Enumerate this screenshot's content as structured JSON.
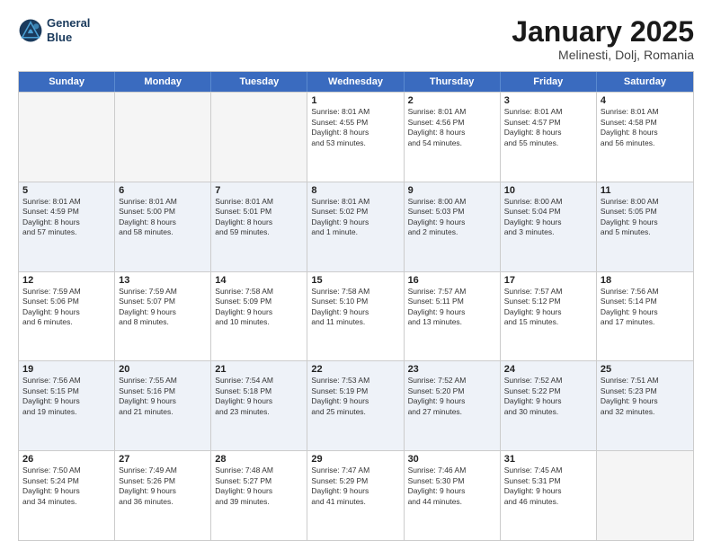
{
  "logo": {
    "line1": "General",
    "line2": "Blue"
  },
  "title": "January 2025",
  "location": "Melinesti, Dolj, Romania",
  "days_header": [
    "Sunday",
    "Monday",
    "Tuesday",
    "Wednesday",
    "Thursday",
    "Friday",
    "Saturday"
  ],
  "weeks": [
    [
      {
        "day": "",
        "empty": true
      },
      {
        "day": "",
        "empty": true
      },
      {
        "day": "",
        "empty": true
      },
      {
        "day": "1",
        "lines": [
          "Sunrise: 8:01 AM",
          "Sunset: 4:55 PM",
          "Daylight: 8 hours",
          "and 53 minutes."
        ]
      },
      {
        "day": "2",
        "lines": [
          "Sunrise: 8:01 AM",
          "Sunset: 4:56 PM",
          "Daylight: 8 hours",
          "and 54 minutes."
        ]
      },
      {
        "day": "3",
        "lines": [
          "Sunrise: 8:01 AM",
          "Sunset: 4:57 PM",
          "Daylight: 8 hours",
          "and 55 minutes."
        ]
      },
      {
        "day": "4",
        "lines": [
          "Sunrise: 8:01 AM",
          "Sunset: 4:58 PM",
          "Daylight: 8 hours",
          "and 56 minutes."
        ]
      }
    ],
    [
      {
        "day": "5",
        "lines": [
          "Sunrise: 8:01 AM",
          "Sunset: 4:59 PM",
          "Daylight: 8 hours",
          "and 57 minutes."
        ]
      },
      {
        "day": "6",
        "lines": [
          "Sunrise: 8:01 AM",
          "Sunset: 5:00 PM",
          "Daylight: 8 hours",
          "and 58 minutes."
        ]
      },
      {
        "day": "7",
        "lines": [
          "Sunrise: 8:01 AM",
          "Sunset: 5:01 PM",
          "Daylight: 8 hours",
          "and 59 minutes."
        ]
      },
      {
        "day": "8",
        "lines": [
          "Sunrise: 8:01 AM",
          "Sunset: 5:02 PM",
          "Daylight: 9 hours",
          "and 1 minute."
        ]
      },
      {
        "day": "9",
        "lines": [
          "Sunrise: 8:00 AM",
          "Sunset: 5:03 PM",
          "Daylight: 9 hours",
          "and 2 minutes."
        ]
      },
      {
        "day": "10",
        "lines": [
          "Sunrise: 8:00 AM",
          "Sunset: 5:04 PM",
          "Daylight: 9 hours",
          "and 3 minutes."
        ]
      },
      {
        "day": "11",
        "lines": [
          "Sunrise: 8:00 AM",
          "Sunset: 5:05 PM",
          "Daylight: 9 hours",
          "and 5 minutes."
        ]
      }
    ],
    [
      {
        "day": "12",
        "lines": [
          "Sunrise: 7:59 AM",
          "Sunset: 5:06 PM",
          "Daylight: 9 hours",
          "and 6 minutes."
        ]
      },
      {
        "day": "13",
        "lines": [
          "Sunrise: 7:59 AM",
          "Sunset: 5:07 PM",
          "Daylight: 9 hours",
          "and 8 minutes."
        ]
      },
      {
        "day": "14",
        "lines": [
          "Sunrise: 7:58 AM",
          "Sunset: 5:09 PM",
          "Daylight: 9 hours",
          "and 10 minutes."
        ]
      },
      {
        "day": "15",
        "lines": [
          "Sunrise: 7:58 AM",
          "Sunset: 5:10 PM",
          "Daylight: 9 hours",
          "and 11 minutes."
        ]
      },
      {
        "day": "16",
        "lines": [
          "Sunrise: 7:57 AM",
          "Sunset: 5:11 PM",
          "Daylight: 9 hours",
          "and 13 minutes."
        ]
      },
      {
        "day": "17",
        "lines": [
          "Sunrise: 7:57 AM",
          "Sunset: 5:12 PM",
          "Daylight: 9 hours",
          "and 15 minutes."
        ]
      },
      {
        "day": "18",
        "lines": [
          "Sunrise: 7:56 AM",
          "Sunset: 5:14 PM",
          "Daylight: 9 hours",
          "and 17 minutes."
        ]
      }
    ],
    [
      {
        "day": "19",
        "lines": [
          "Sunrise: 7:56 AM",
          "Sunset: 5:15 PM",
          "Daylight: 9 hours",
          "and 19 minutes."
        ]
      },
      {
        "day": "20",
        "lines": [
          "Sunrise: 7:55 AM",
          "Sunset: 5:16 PM",
          "Daylight: 9 hours",
          "and 21 minutes."
        ]
      },
      {
        "day": "21",
        "lines": [
          "Sunrise: 7:54 AM",
          "Sunset: 5:18 PM",
          "Daylight: 9 hours",
          "and 23 minutes."
        ]
      },
      {
        "day": "22",
        "lines": [
          "Sunrise: 7:53 AM",
          "Sunset: 5:19 PM",
          "Daylight: 9 hours",
          "and 25 minutes."
        ]
      },
      {
        "day": "23",
        "lines": [
          "Sunrise: 7:52 AM",
          "Sunset: 5:20 PM",
          "Daylight: 9 hours",
          "and 27 minutes."
        ]
      },
      {
        "day": "24",
        "lines": [
          "Sunrise: 7:52 AM",
          "Sunset: 5:22 PM",
          "Daylight: 9 hours",
          "and 30 minutes."
        ]
      },
      {
        "day": "25",
        "lines": [
          "Sunrise: 7:51 AM",
          "Sunset: 5:23 PM",
          "Daylight: 9 hours",
          "and 32 minutes."
        ]
      }
    ],
    [
      {
        "day": "26",
        "lines": [
          "Sunrise: 7:50 AM",
          "Sunset: 5:24 PM",
          "Daylight: 9 hours",
          "and 34 minutes."
        ]
      },
      {
        "day": "27",
        "lines": [
          "Sunrise: 7:49 AM",
          "Sunset: 5:26 PM",
          "Daylight: 9 hours",
          "and 36 minutes."
        ]
      },
      {
        "day": "28",
        "lines": [
          "Sunrise: 7:48 AM",
          "Sunset: 5:27 PM",
          "Daylight: 9 hours",
          "and 39 minutes."
        ]
      },
      {
        "day": "29",
        "lines": [
          "Sunrise: 7:47 AM",
          "Sunset: 5:29 PM",
          "Daylight: 9 hours",
          "and 41 minutes."
        ]
      },
      {
        "day": "30",
        "lines": [
          "Sunrise: 7:46 AM",
          "Sunset: 5:30 PM",
          "Daylight: 9 hours",
          "and 44 minutes."
        ]
      },
      {
        "day": "31",
        "lines": [
          "Sunrise: 7:45 AM",
          "Sunset: 5:31 PM",
          "Daylight: 9 hours",
          "and 46 minutes."
        ]
      },
      {
        "day": "",
        "empty": true
      }
    ]
  ]
}
